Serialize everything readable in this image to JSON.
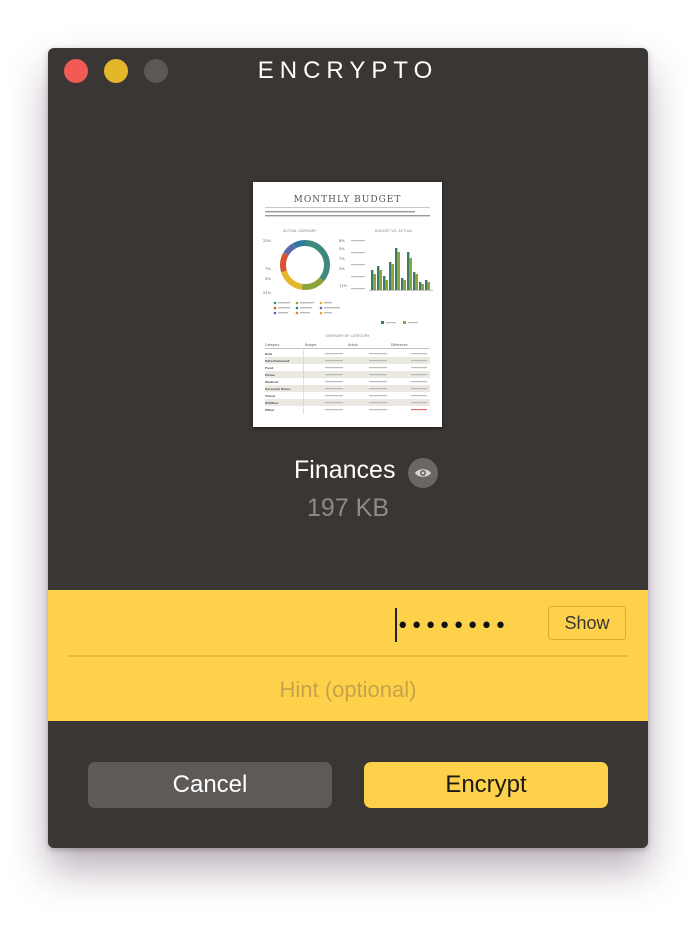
{
  "window": {
    "title": "ENCRYPTO"
  },
  "file": {
    "name": "Finances",
    "size": "197 KB",
    "preview_icon": "eye-icon"
  },
  "preview_doc": {
    "heading": "MONTHLY BUDGET",
    "chart_left_title": "ACTUAL SUMMARY",
    "chart_right_title": "BUDGET VS. ACTUAL",
    "table_title": "SUMMARY BY CATEGORY",
    "table_headers": [
      "Category",
      "Budget",
      "Actual",
      "Difference"
    ],
    "table_rows": [
      "Kids",
      "Entertainment",
      "Food",
      "Home",
      "Medical",
      "Personal Items",
      "Travel",
      "Utilities",
      "Other"
    ]
  },
  "password": {
    "value": "••••••••",
    "show_label": "Show",
    "hint_placeholder": "Hint (optional)"
  },
  "actions": {
    "cancel_label": "Cancel",
    "encrypt_label": "Encrypt"
  },
  "colors": {
    "window_bg": "#3a3633",
    "accent_yellow": "#fdd14a",
    "close": "#f25a55",
    "minimize": "#e4b72b",
    "zoom_disabled": "#5c5855"
  }
}
